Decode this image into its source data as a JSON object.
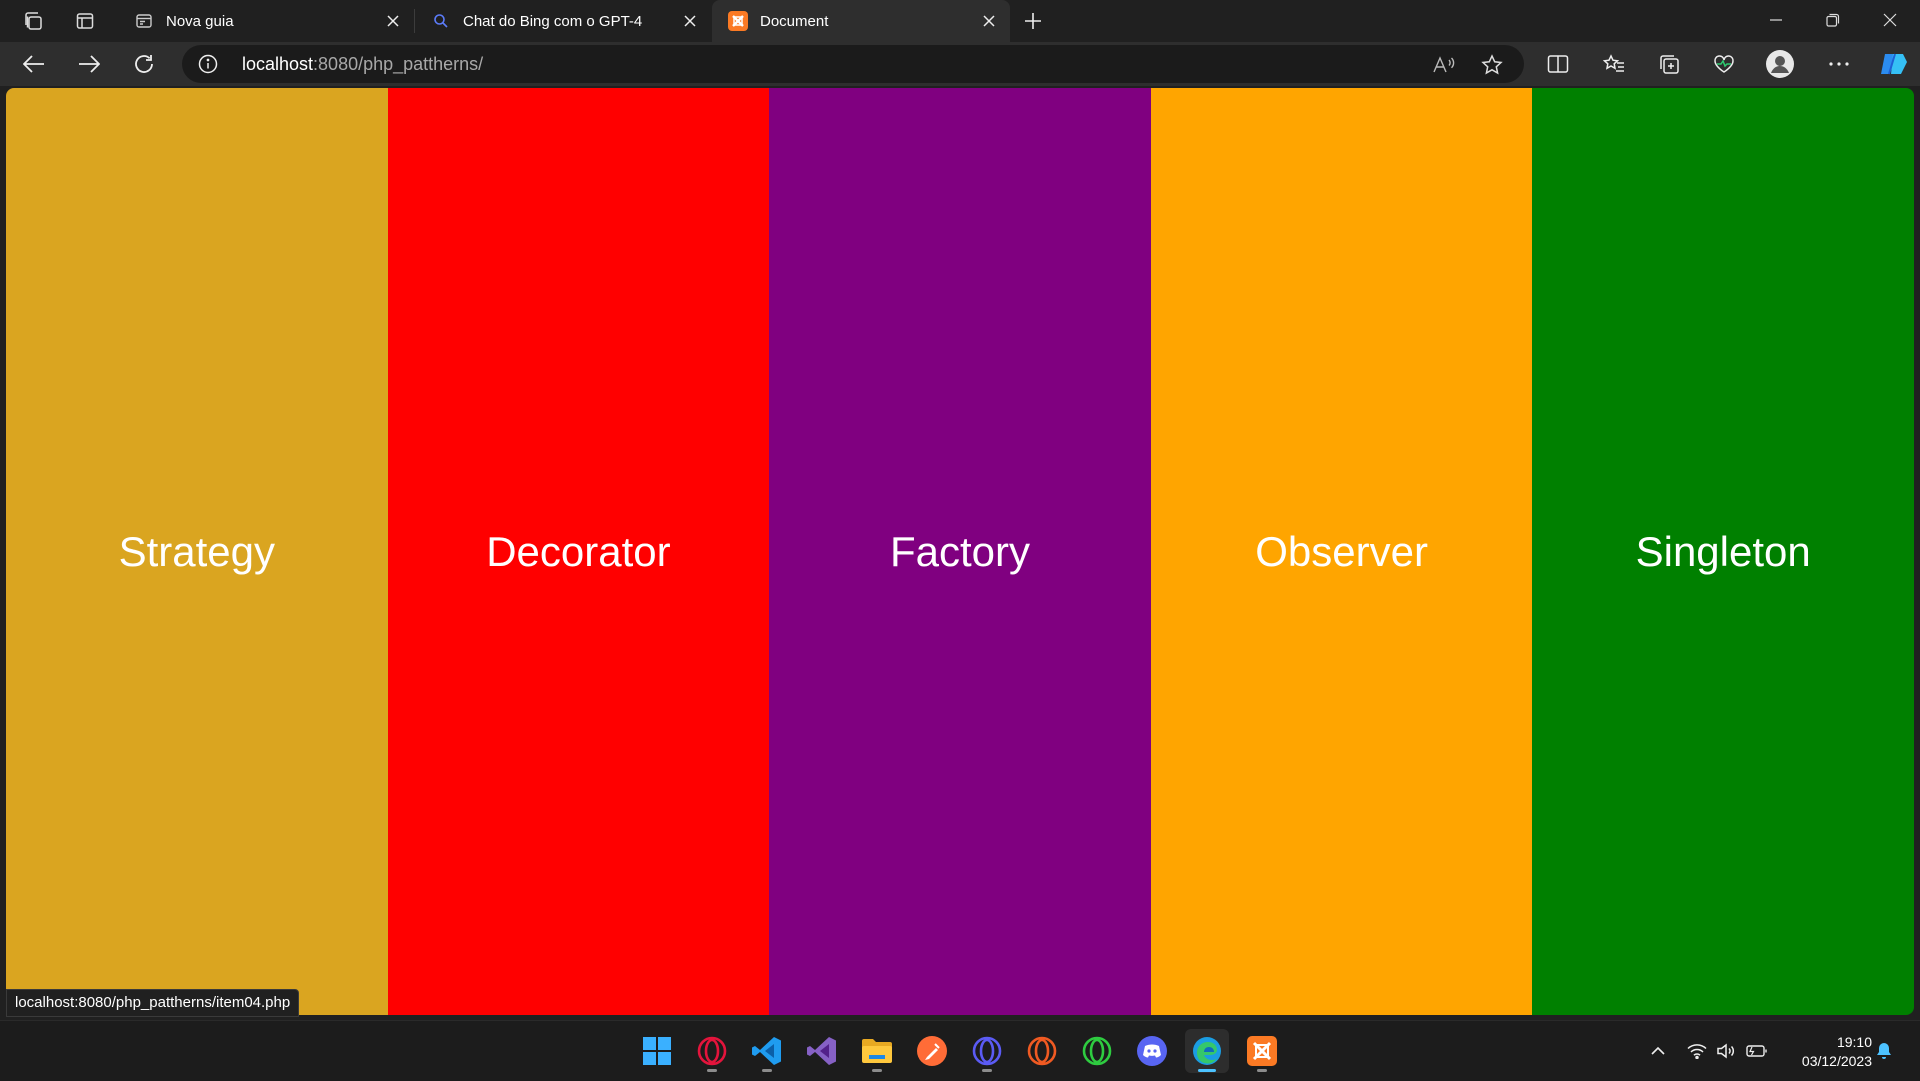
{
  "browser": {
    "tabs": [
      {
        "title": "Nova guia",
        "icon": "new-tab-page-icon",
        "active": false
      },
      {
        "title": "Chat do Bing com o GPT-4",
        "icon": "bing-search-icon",
        "active": false
      },
      {
        "title": "Document",
        "icon": "xampp-icon",
        "active": true
      }
    ],
    "address": {
      "host": "localhost",
      "rest": ":8080/php_pattherns/"
    },
    "status_url": "localhost:8080/php_pattherns/item04.php"
  },
  "page": {
    "panels": [
      {
        "label": "Strategy",
        "color": "#daa520"
      },
      {
        "label": "Decorator",
        "color": "#ff0000"
      },
      {
        "label": "Factory",
        "color": "#800080"
      },
      {
        "label": "Observer",
        "color": "#ffa500"
      },
      {
        "label": "Singleton",
        "color": "#008000"
      }
    ]
  },
  "taskbar": {
    "apps": [
      "windows-start-icon",
      "opera-gx-icon",
      "vs-code-icon",
      "visual-studio-icon",
      "file-explorer-icon",
      "postman-icon",
      "opera-icon",
      "opera-orange-icon",
      "opera-green-icon",
      "discord-icon",
      "edge-icon",
      "xampp-icon"
    ],
    "time": "19:10",
    "date": "03/12/2023"
  }
}
